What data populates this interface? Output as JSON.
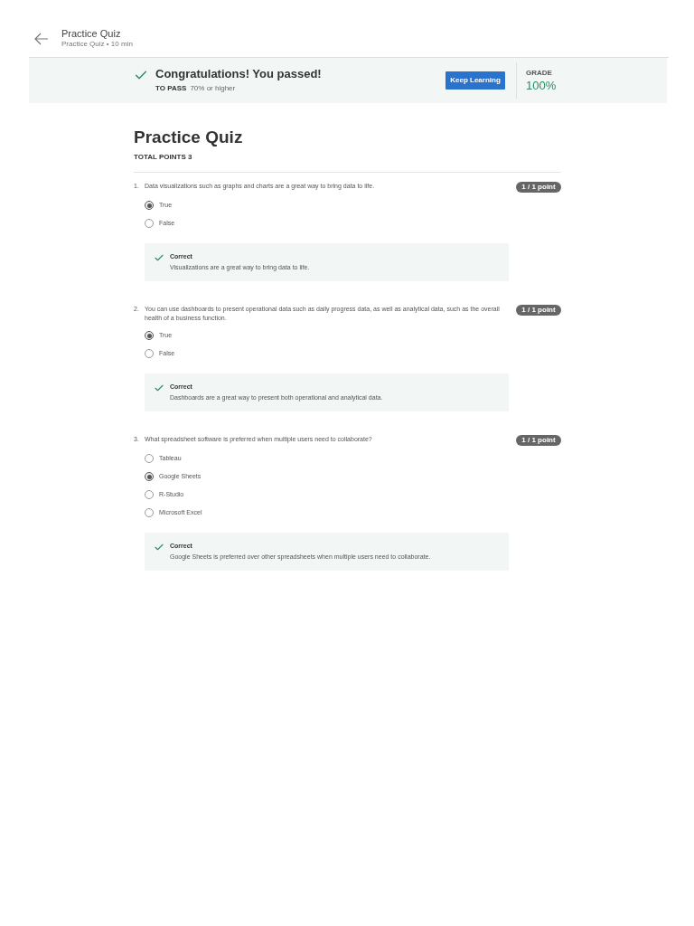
{
  "header": {
    "title": "Practice Quiz",
    "subtitle": "Practice Quiz • 10 min"
  },
  "banner": {
    "message": "Congratulations! You passed!",
    "pass_label": "TO PASS",
    "pass_value": "70% or higher",
    "button": "Keep Learning",
    "grade_label": "GRADE",
    "grade": "100%"
  },
  "quiz": {
    "title": "Practice Quiz",
    "total_points": "TOTAL POINTS 3"
  },
  "questions": [
    {
      "number": "1.",
      "text": "Data visualizations such as graphs and charts are a great way to bring data to life.",
      "score": "1 / 1 point",
      "options": [
        {
          "label": "True",
          "selected": true
        },
        {
          "label": "False",
          "selected": false
        }
      ],
      "feedback": {
        "title": "Correct",
        "text": "Visualizations are a great way to bring data to life."
      }
    },
    {
      "number": "2.",
      "text": "You can use dashboards to present operational data such as daily progress data, as well as analytical data, such as the overall health of a business function.",
      "score": "1 / 1 point",
      "options": [
        {
          "label": "True",
          "selected": true
        },
        {
          "label": "False",
          "selected": false
        }
      ],
      "feedback": {
        "title": "Correct",
        "text": "Dashboards are a great way to present both operational and analytical data."
      }
    },
    {
      "number": "3.",
      "text": "What spreadsheet software is preferred when multiple users need to collaborate?",
      "score": "1 / 1 point",
      "options": [
        {
          "label": "Tableau",
          "selected": false
        },
        {
          "label": "Google Sheets",
          "selected": true
        },
        {
          "label": "R-Studio",
          "selected": false
        },
        {
          "label": "Microsoft Excel",
          "selected": false
        }
      ],
      "feedback": {
        "title": "Correct",
        "text": "Google Sheets is preferred over other spreadsheets when multiple users need to collaborate."
      }
    }
  ]
}
